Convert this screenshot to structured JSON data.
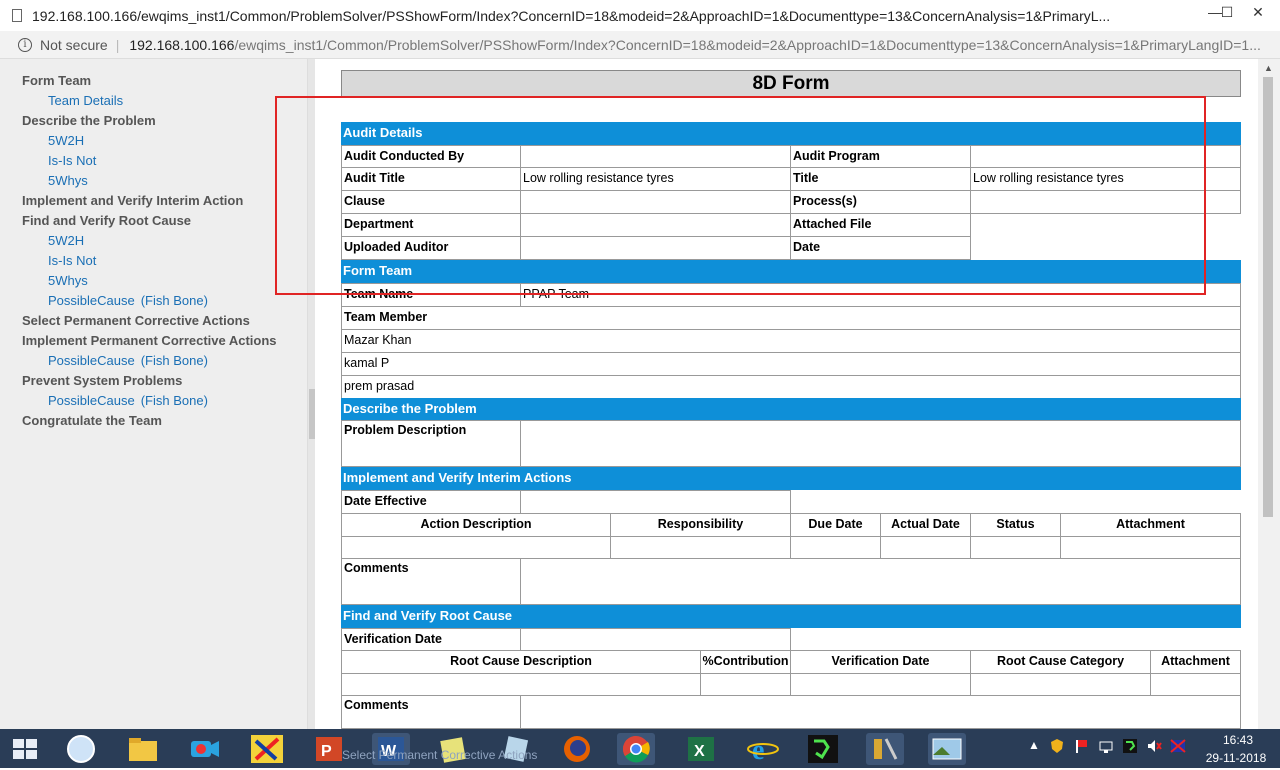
{
  "browser": {
    "window_title": "192.168.100.166/ewqims_inst1/Common/ProblemSolver/PSShowForm/Index?ConcernID=18&modeid=2&ApproachID=1&Documenttype=13&ConcernAnalysis=1&PrimaryL...",
    "minimize": "—",
    "maximize": "☐",
    "close": "✕",
    "info_glyph": "i",
    "not_secure": "Not secure",
    "separator": "|",
    "url_host": "192.168.100.166",
    "url_path": "/ewqims_inst1/Common/ProblemSolver/PSShowForm/Index?ConcernID=18&modeid=2&ApproachID=1&Documenttype=13&ConcernAnalysis=1&PrimaryLangID=1..."
  },
  "sidebar": {
    "items": [
      {
        "label": "Form Team",
        "level": "top"
      },
      {
        "label": "Team Details",
        "level": "sub"
      },
      {
        "label": "Describe the Problem",
        "level": "top"
      },
      {
        "label": "5W2H",
        "level": "sub"
      },
      {
        "label": "Is-Is Not",
        "level": "sub"
      },
      {
        "label": "5Whys",
        "level": "sub"
      },
      {
        "label": "Implement and Verify Interim Action",
        "level": "top"
      },
      {
        "label": "Find and Verify Root Cause",
        "level": "top"
      },
      {
        "label": "5W2H",
        "level": "sub"
      },
      {
        "label": "Is-Is Not",
        "level": "sub"
      },
      {
        "label": "5Whys",
        "level": "sub"
      },
      {
        "label": "PossibleCause",
        "suffix": "(Fish Bone)",
        "level": "sub"
      },
      {
        "label": "Select Permanent Corrective Actions",
        "level": "top"
      },
      {
        "label": "Implement Permanent Corrective Actions",
        "level": "top"
      },
      {
        "label": "PossibleCause",
        "suffix": "(Fish Bone)",
        "level": "sub"
      },
      {
        "label": "Prevent System Problems",
        "level": "top"
      },
      {
        "label": "PossibleCause",
        "suffix": "(Fish Bone)",
        "level": "sub"
      },
      {
        "label": "Congratulate the Team",
        "level": "top"
      }
    ]
  },
  "form": {
    "title": "8D Form",
    "audit": {
      "header": "Audit Details",
      "conducted_by_label": "Audit Conducted By",
      "conducted_by_value": "",
      "program_label": "Audit Program",
      "program_value": "",
      "audit_title_label": "Audit Title",
      "audit_title_value": "Low rolling resistance tyres",
      "title_label": "Title",
      "title_value": "Low rolling resistance tyres",
      "clause_label": "Clause",
      "clause_value": "",
      "process_label": "Process(s)",
      "process_value": "",
      "department_label": "Department",
      "department_value": "",
      "attached_label": "Attached File",
      "uploaded_label": "Uploaded Auditor",
      "uploaded_value": "",
      "date_label": "Date"
    },
    "team": {
      "header": "Form Team",
      "name_label": "Team Name",
      "name_value": "PPAP Team",
      "member_label": "Team Member",
      "members": [
        "Mazar Khan",
        "kamal P",
        "prem prasad"
      ]
    },
    "problem": {
      "header": "Describe the Problem",
      "desc_label": "Problem Description",
      "desc_value": ""
    },
    "interim": {
      "header": "Implement and Verify Interim Actions",
      "date_label": "Date Effective",
      "columns": [
        "Action Description",
        "Responsibility",
        "Due Date",
        "Actual Date",
        "Status",
        "Attachment"
      ],
      "comments_label": "Comments"
    },
    "root": {
      "header": "Find and Verify Root Cause",
      "date_label": "Verification Date",
      "columns": [
        "Root Cause Description",
        "%Contribution",
        "Verification Date",
        "Root Cause Category",
        "Attachment"
      ],
      "comments_label": "Comments"
    }
  },
  "taskbar": {
    "ghost_text": "Select Permanent Corrective Actions",
    "time": "16:43",
    "date": "29-11-2018"
  },
  "colors": {
    "section_header": "#0e8fd8",
    "highlight_box": "#e02424",
    "sidebar_bg": "#eeeeee",
    "link": "#1a6fb5"
  }
}
